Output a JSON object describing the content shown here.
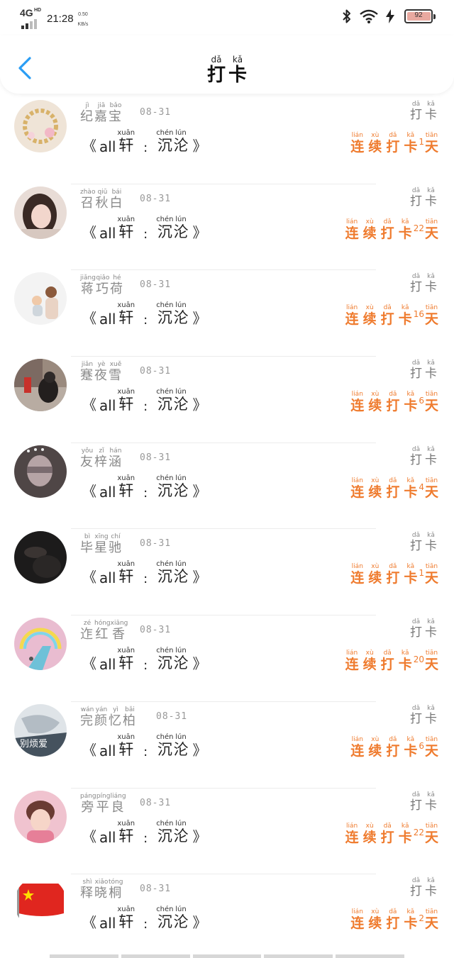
{
  "status_bar": {
    "network": "4G",
    "network_sup": "HD",
    "time": "21:28",
    "speed_value": "0.50",
    "speed_unit": "KB/s",
    "battery_level": "92",
    "icons": [
      "bluetooth-icon",
      "wifi-icon",
      "charging-icon",
      "battery-icon"
    ]
  },
  "header": {
    "title_chars": [
      {
        "ch": "打",
        "py": "dǎ"
      },
      {
        "ch": "卡",
        "py": "kǎ"
      }
    ],
    "back_icon": "chevron-left-icon"
  },
  "colors": {
    "accent_orange": "#ef7b2e",
    "back_blue": "#2a9df4",
    "name_gray": "#8a8a8a"
  },
  "entries": [
    {
      "name": [
        {
          "ch": "纪",
          "py": "jì"
        },
        {
          "ch": "嘉",
          "py": "jiā"
        },
        {
          "ch": "宝",
          "py": "bǎo"
        }
      ],
      "date": "08-31",
      "book_left": "《",
      "book_en": "all",
      "book_chars1": [
        {
          "ch": "轩",
          "py": "xuān"
        }
      ],
      "book_colon": ":",
      "book_chars2": [
        {
          "ch": "沉",
          "py": "chén"
        },
        {
          "ch": "沦",
          "py": "lún"
        }
      ],
      "book_right": "》",
      "punch": [
        {
          "ch": "打",
          "py": "dǎ"
        },
        {
          "ch": "卡",
          "py": "kǎ"
        }
      ],
      "streak_prefix": [
        {
          "ch": "连",
          "py": "lián"
        },
        {
          "ch": "续",
          "py": "xù"
        },
        {
          "ch": "打",
          "py": "dǎ"
        },
        {
          "ch": "卡",
          "py": "kǎ"
        }
      ],
      "days": "1",
      "streak_suffix": [
        {
          "ch": "天",
          "py": "tiān"
        }
      ],
      "avatar_icon": "bracelet-avatar"
    },
    {
      "name": [
        {
          "ch": "召",
          "py": "zhào"
        },
        {
          "ch": "秋",
          "py": "qiū"
        },
        {
          "ch": "白",
          "py": "bái"
        }
      ],
      "date": "08-31",
      "book_left": "《",
      "book_en": "all",
      "book_chars1": [
        {
          "ch": "轩",
          "py": "xuān"
        }
      ],
      "book_colon": ":",
      "book_chars2": [
        {
          "ch": "沉",
          "py": "chén"
        },
        {
          "ch": "沦",
          "py": "lún"
        }
      ],
      "book_right": "》",
      "punch": [
        {
          "ch": "打",
          "py": "dǎ"
        },
        {
          "ch": "卡",
          "py": "kǎ"
        }
      ],
      "streak_prefix": [
        {
          "ch": "连",
          "py": "lián"
        },
        {
          "ch": "续",
          "py": "xù"
        },
        {
          "ch": "打",
          "py": "dǎ"
        },
        {
          "ch": "卡",
          "py": "kǎ"
        }
      ],
      "days": "22",
      "streak_suffix": [
        {
          "ch": "天",
          "py": "tiān"
        }
      ],
      "avatar_icon": "girl-portrait-avatar"
    },
    {
      "name": [
        {
          "ch": "蒋",
          "py": "jiǎng"
        },
        {
          "ch": "巧",
          "py": "qiǎo"
        },
        {
          "ch": "荷",
          "py": "hé"
        }
      ],
      "date": "08-31",
      "book_left": "《",
      "book_en": "all",
      "book_chars1": [
        {
          "ch": "轩",
          "py": "xuān"
        }
      ],
      "book_colon": ":",
      "book_chars2": [
        {
          "ch": "沉",
          "py": "chén"
        },
        {
          "ch": "沦",
          "py": "lún"
        }
      ],
      "book_right": "》",
      "punch": [
        {
          "ch": "打",
          "py": "dǎ"
        },
        {
          "ch": "卡",
          "py": "kǎ"
        }
      ],
      "streak_prefix": [
        {
          "ch": "连",
          "py": "lián"
        },
        {
          "ch": "续",
          "py": "xù"
        },
        {
          "ch": "打",
          "py": "dǎ"
        },
        {
          "ch": "卡",
          "py": "kǎ"
        }
      ],
      "days": "16",
      "streak_suffix": [
        {
          "ch": "天",
          "py": "tiān"
        }
      ],
      "avatar_icon": "parent-child-avatar"
    },
    {
      "name": [
        {
          "ch": "蹇",
          "py": "jiǎn"
        },
        {
          "ch": "夜",
          "py": "yè"
        },
        {
          "ch": "雪",
          "py": "xuě"
        }
      ],
      "date": "08-31",
      "book_left": "《",
      "book_en": "all",
      "book_chars1": [
        {
          "ch": "轩",
          "py": "xuān"
        }
      ],
      "book_colon": ":",
      "book_chars2": [
        {
          "ch": "沉",
          "py": "chén"
        },
        {
          "ch": "沦",
          "py": "lún"
        }
      ],
      "book_right": "》",
      "punch": [
        {
          "ch": "打",
          "py": "dǎ"
        },
        {
          "ch": "卡",
          "py": "kǎ"
        }
      ],
      "streak_prefix": [
        {
          "ch": "连",
          "py": "lián"
        },
        {
          "ch": "续",
          "py": "xù"
        },
        {
          "ch": "打",
          "py": "dǎ"
        },
        {
          "ch": "卡",
          "py": "kǎ"
        }
      ],
      "days": "6",
      "streak_suffix": [
        {
          "ch": "天",
          "py": "tiān"
        }
      ],
      "avatar_icon": "street-scene-avatar"
    },
    {
      "name": [
        {
          "ch": "友",
          "py": "yǒu"
        },
        {
          "ch": "梓",
          "py": "zǐ"
        },
        {
          "ch": "涵",
          "py": "hán"
        }
      ],
      "date": "08-31",
      "book_left": "《",
      "book_en": "all",
      "book_chars1": [
        {
          "ch": "轩",
          "py": "xuān"
        }
      ],
      "book_colon": ":",
      "book_chars2": [
        {
          "ch": "沉",
          "py": "chén"
        },
        {
          "ch": "沦",
          "py": "lún"
        }
      ],
      "book_right": "》",
      "punch": [
        {
          "ch": "打",
          "py": "dǎ"
        },
        {
          "ch": "卡",
          "py": "kǎ"
        }
      ],
      "streak_prefix": [
        {
          "ch": "连",
          "py": "lián"
        },
        {
          "ch": "续",
          "py": "xù"
        },
        {
          "ch": "打",
          "py": "dǎ"
        },
        {
          "ch": "卡",
          "py": "kǎ"
        }
      ],
      "days": "4",
      "streak_suffix": [
        {
          "ch": "天",
          "py": "tiān"
        }
      ],
      "avatar_icon": "blurred-girl-avatar"
    },
    {
      "name": [
        {
          "ch": "毕",
          "py": "bì"
        },
        {
          "ch": "星",
          "py": "xīng"
        },
        {
          "ch": "驰",
          "py": "chí"
        }
      ],
      "date": "08-31",
      "book_left": "《",
      "book_en": "all",
      "book_chars1": [
        {
          "ch": "轩",
          "py": "xuān"
        }
      ],
      "book_colon": ":",
      "book_chars2": [
        {
          "ch": "沉",
          "py": "chén"
        },
        {
          "ch": "沦",
          "py": "lún"
        }
      ],
      "book_right": "》",
      "punch": [
        {
          "ch": "打",
          "py": "dǎ"
        },
        {
          "ch": "卡",
          "py": "kǎ"
        }
      ],
      "streak_prefix": [
        {
          "ch": "连",
          "py": "lián"
        },
        {
          "ch": "续",
          "py": "xù"
        },
        {
          "ch": "打",
          "py": "dǎ"
        },
        {
          "ch": "卡",
          "py": "kǎ"
        }
      ],
      "days": "1",
      "streak_suffix": [
        {
          "ch": "天",
          "py": "tiān"
        }
      ],
      "avatar_icon": "dark-hands-avatar"
    },
    {
      "name": [
        {
          "ch": "迮",
          "py": "zé"
        },
        {
          "ch": "红",
          "py": "hóng"
        },
        {
          "ch": "香",
          "py": "xiāng"
        }
      ],
      "date": "08-31",
      "book_left": "《",
      "book_en": "all",
      "book_chars1": [
        {
          "ch": "轩",
          "py": "xuān"
        }
      ],
      "book_colon": ":",
      "book_chars2": [
        {
          "ch": "沉",
          "py": "chén"
        },
        {
          "ch": "沦",
          "py": "lún"
        }
      ],
      "book_right": "》",
      "punch": [
        {
          "ch": "打",
          "py": "dǎ"
        },
        {
          "ch": "卡",
          "py": "kǎ"
        }
      ],
      "streak_prefix": [
        {
          "ch": "连",
          "py": "lián"
        },
        {
          "ch": "续",
          "py": "xù"
        },
        {
          "ch": "打",
          "py": "dǎ"
        },
        {
          "ch": "卡",
          "py": "kǎ"
        }
      ],
      "days": "20",
      "streak_suffix": [
        {
          "ch": "天",
          "py": "tiān"
        }
      ],
      "avatar_icon": "rainbow-avatar"
    },
    {
      "name": [
        {
          "ch": "完",
          "py": "wán"
        },
        {
          "ch": "颜",
          "py": "yán"
        },
        {
          "ch": "忆",
          "py": "yì"
        },
        {
          "ch": "柏",
          "py": "bǎi"
        }
      ],
      "date": "08-31",
      "book_left": "《",
      "book_en": "all",
      "book_chars1": [
        {
          "ch": "轩",
          "py": "xuān"
        }
      ],
      "book_colon": ":",
      "book_chars2": [
        {
          "ch": "沉",
          "py": "chén"
        },
        {
          "ch": "沦",
          "py": "lún"
        }
      ],
      "book_right": "》",
      "punch": [
        {
          "ch": "打",
          "py": "dǎ"
        },
        {
          "ch": "卡",
          "py": "kǎ"
        }
      ],
      "streak_prefix": [
        {
          "ch": "连",
          "py": "lián"
        },
        {
          "ch": "续",
          "py": "xù"
        },
        {
          "ch": "打",
          "py": "dǎ"
        },
        {
          "ch": "卡",
          "py": "kǎ"
        }
      ],
      "days": "6",
      "streak_suffix": [
        {
          "ch": "天",
          "py": "tiān"
        }
      ],
      "avatar_icon": "sketch-text-avatar",
      "avatar_caption": "别烦爱"
    },
    {
      "name": [
        {
          "ch": "旁",
          "py": "páng"
        },
        {
          "ch": "平",
          "py": "píng"
        },
        {
          "ch": "良",
          "py": "liáng"
        }
      ],
      "date": "08-31",
      "book_left": "《",
      "book_en": "all",
      "book_chars1": [
        {
          "ch": "轩",
          "py": "xuān"
        }
      ],
      "book_colon": ":",
      "book_chars2": [
        {
          "ch": "沉",
          "py": "chén"
        },
        {
          "ch": "沦",
          "py": "lún"
        }
      ],
      "book_right": "》",
      "punch": [
        {
          "ch": "打",
          "py": "dǎ"
        },
        {
          "ch": "卡",
          "py": "kǎ"
        }
      ],
      "streak_prefix": [
        {
          "ch": "连",
          "py": "lián"
        },
        {
          "ch": "续",
          "py": "xù"
        },
        {
          "ch": "打",
          "py": "dǎ"
        },
        {
          "ch": "卡",
          "py": "kǎ"
        }
      ],
      "days": "22",
      "streak_suffix": [
        {
          "ch": "天",
          "py": "tiān"
        }
      ],
      "avatar_icon": "boy-pink-avatar"
    },
    {
      "name": [
        {
          "ch": "释",
          "py": "shì"
        },
        {
          "ch": "晓",
          "py": "xiǎo"
        },
        {
          "ch": "桐",
          "py": "tóng"
        }
      ],
      "date": "08-31",
      "book_left": "《",
      "book_en": "all",
      "book_chars1": [
        {
          "ch": "轩",
          "py": "xuān"
        }
      ],
      "book_colon": ":",
      "book_chars2": [
        {
          "ch": "沉",
          "py": "chén"
        },
        {
          "ch": "沦",
          "py": "lún"
        }
      ],
      "book_right": "》",
      "punch": [
        {
          "ch": "打",
          "py": "dǎ"
        },
        {
          "ch": "卡",
          "py": "kǎ"
        }
      ],
      "streak_prefix": [
        {
          "ch": "连",
          "py": "lián"
        },
        {
          "ch": "续",
          "py": "xù"
        },
        {
          "ch": "打",
          "py": "dǎ"
        },
        {
          "ch": "卡",
          "py": "kǎ"
        }
      ],
      "days": "2",
      "streak_suffix": [
        {
          "ch": "天",
          "py": "tiān"
        }
      ],
      "avatar_icon": "china-flag-avatar"
    }
  ]
}
